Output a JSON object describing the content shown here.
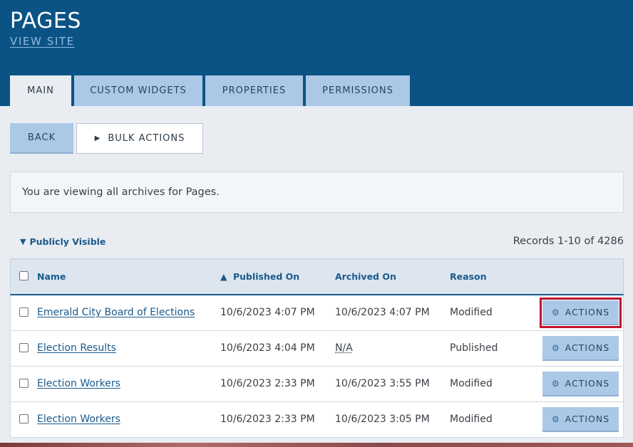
{
  "header": {
    "title": "PAGES",
    "view_site": "VIEW SITE"
  },
  "tabs": [
    {
      "label": "MAIN",
      "active": true
    },
    {
      "label": "CUSTOM WIDGETS"
    },
    {
      "label": "PROPERTIES"
    },
    {
      "label": "PERMISSIONS"
    }
  ],
  "toolbar": {
    "back_label": "BACK",
    "bulk_icon": "play-triangle-icon",
    "bulk_label": "BULK ACTIONS"
  },
  "notice": "You are viewing all archives for Pages.",
  "filter": {
    "label": "Publicly Visible",
    "icon": "triangle-down-icon"
  },
  "records": "Records 1-10 of 4286",
  "table": {
    "columns": {
      "name": "Name",
      "published_on": "Published On",
      "archived_on": "Archived On",
      "reason": "Reason"
    },
    "sort": {
      "column": "published_on",
      "direction": "ascending"
    },
    "action_label": "ACTIONS",
    "action_icon": "gear-icon",
    "rows": [
      {
        "name": "Emerald City Board of Elections",
        "published_on": "10/6/2023 4:07 PM",
        "archived_on": "10/6/2023 4:07 PM",
        "reason": "Modified"
      },
      {
        "name": "Election Results",
        "published_on": "10/6/2023 4:04 PM",
        "archived_on": "N/A",
        "reason": "Published"
      },
      {
        "name": "Election Workers",
        "published_on": "10/6/2023 2:33 PM",
        "archived_on": "10/6/2023 3:55 PM",
        "reason": "Modified"
      },
      {
        "name": "Election Workers",
        "published_on": "10/6/2023 2:33 PM",
        "archived_on": "10/6/2023 3:05 PM",
        "reason": "Modified"
      }
    ]
  },
  "colors": {
    "header_bg": "#0b5385",
    "tab_bg": "#abc8e6",
    "link": "#1a5a8c",
    "focus_outline": "#c0142d"
  }
}
